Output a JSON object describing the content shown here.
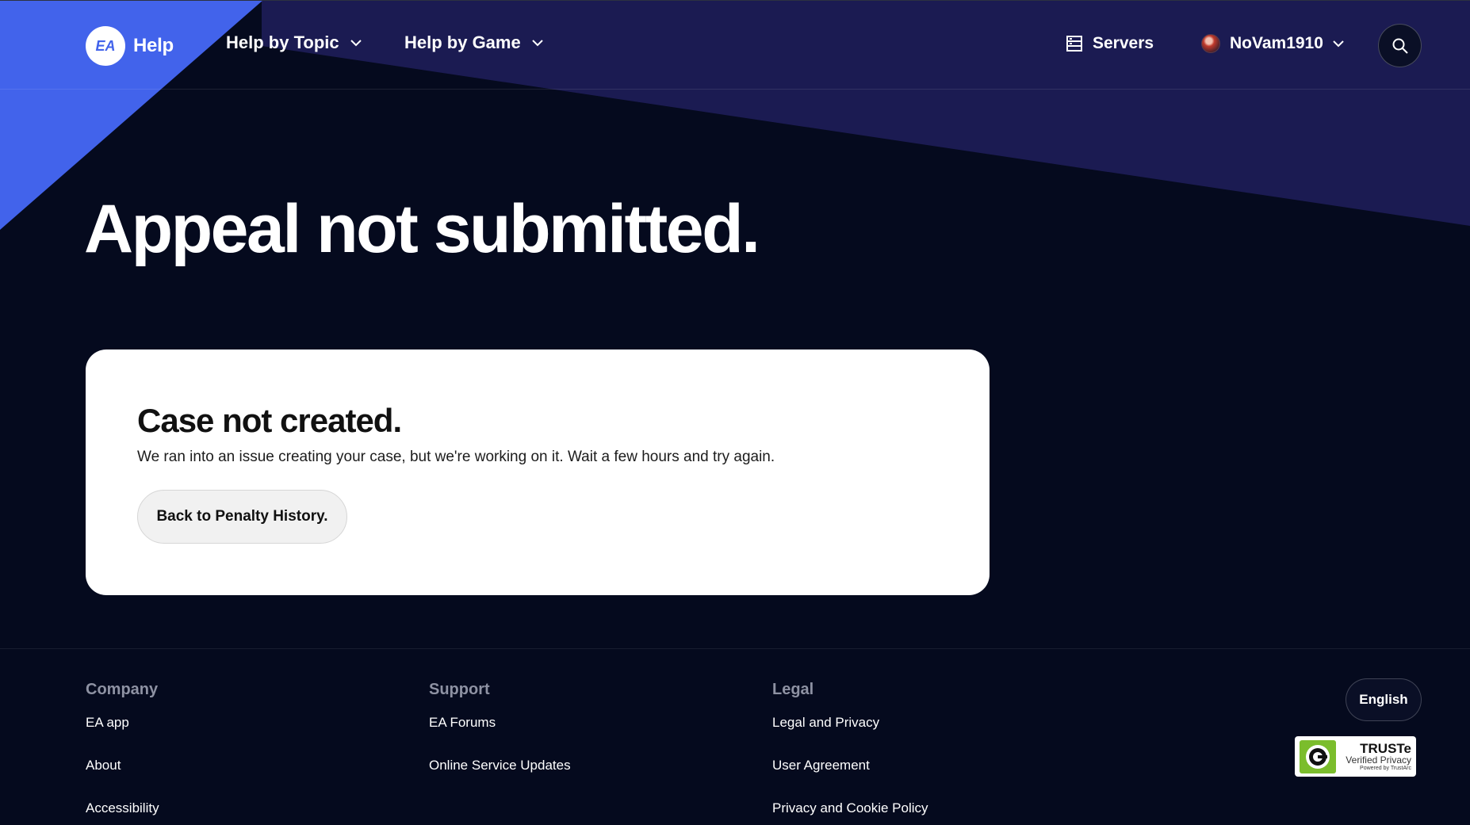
{
  "header": {
    "logo_text": "EA",
    "help_label": "Help",
    "nav": [
      {
        "label": "Help by Topic"
      },
      {
        "label": "Help by Game"
      }
    ],
    "servers_label": "Servers",
    "username": "NoVam1910"
  },
  "hero": {
    "title": "Appeal not submitted."
  },
  "card": {
    "title": "Case not created.",
    "message": "We ran into an issue creating your case, but we're working on it. Wait a few hours and try again.",
    "button_label": "Back to Penalty History."
  },
  "footer": {
    "columns": [
      {
        "heading": "Company",
        "links": [
          "EA app",
          "About",
          "Accessibility"
        ]
      },
      {
        "heading": "Support",
        "links": [
          "EA Forums",
          "Online Service Updates"
        ]
      },
      {
        "heading": "Legal",
        "links": [
          "Legal and Privacy",
          "User Agreement",
          "Privacy and Cookie Policy"
        ]
      }
    ],
    "language": "English",
    "truste": {
      "title": "TRUSTe",
      "subtitle": "Verified Privacy",
      "powered": "Powered by TrustArc"
    }
  },
  "colors": {
    "background": "#050a1e",
    "accent_blue": "#4263eb",
    "accent_indigo": "#1a1a55",
    "card": "#ffffff"
  },
  "icons": [
    "ea-logo-icon",
    "chevron-down-icon",
    "servers-icon",
    "search-icon",
    "truste-logo-icon"
  ]
}
